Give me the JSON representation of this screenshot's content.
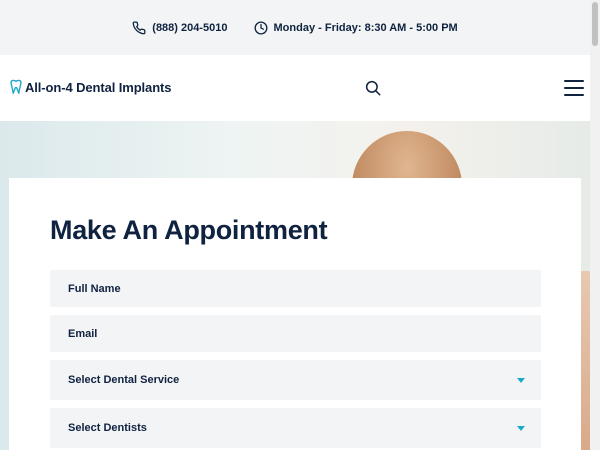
{
  "topbar": {
    "phone": "(888) 204-5010",
    "hours": "Monday - Friday: 8:30 AM - 5:00 PM"
  },
  "header": {
    "logo_text": "All-on-4 Dental Implants"
  },
  "appointment": {
    "title": "Make An Appointment",
    "full_name_placeholder": "Full Name",
    "email_placeholder": "Email",
    "service_select": "Select Dental Service",
    "dentist_select": "Select Dentists"
  },
  "colors": {
    "navy": "#0f2240",
    "accent": "#1fa8c9",
    "field_bg": "#f3f4f5"
  }
}
